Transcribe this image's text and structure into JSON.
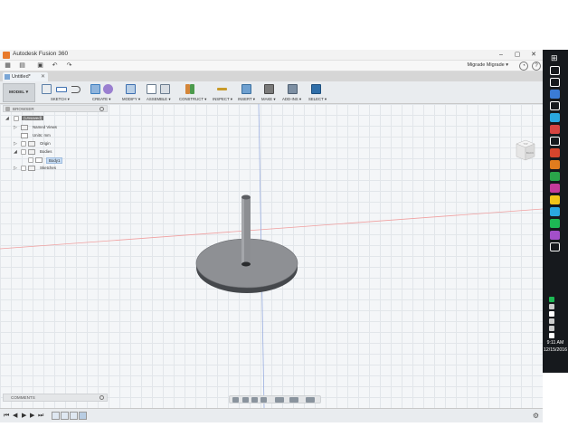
{
  "window": {
    "title": "Autodesk Fusion 360",
    "controls": [
      "–",
      "▢",
      "✕"
    ]
  },
  "quick_access": {
    "user_label": "Migrade Migrade ▾",
    "icons": [
      "grid-icon",
      "file-icon",
      "save-icon",
      "undo-icon",
      "redo-icon"
    ]
  },
  "document_tab": {
    "label": "Untitled*",
    "close": "✕"
  },
  "ribbon": {
    "workspace_label": "MODEL ▾",
    "groups": [
      {
        "label": "SKETCH ▾"
      },
      {
        "label": "CREATE ▾"
      },
      {
        "label": "MODIFY ▾"
      },
      {
        "label": "ASSEMBLE ▾"
      },
      {
        "label": "CONSTRUCT ▾"
      },
      {
        "label": "INSPECT ▾"
      },
      {
        "label": "INSERT ▾"
      },
      {
        "label": "MAKE ▾"
      },
      {
        "label": "ADD-INS ▾"
      },
      {
        "label": "SELECT ▾"
      }
    ],
    "colors": {
      "sketch": "#5b7fa8",
      "create": "#3d7fc0",
      "modify": "#3d6fb0",
      "assemble": "#6b7c8f",
      "construct": "#d4863a",
      "inspect": "#c89a2a",
      "insert": "#4a86b8",
      "make": "#6a6a6a",
      "addins": "#5a6d82",
      "select": "#2f6ea8"
    }
  },
  "browser": {
    "header": "BROWSER",
    "items": [
      {
        "label": "(Unsaved)",
        "level": 0,
        "type": "document"
      },
      {
        "label": "Named Views",
        "level": 1,
        "type": "folder"
      },
      {
        "label": "Units: mm",
        "level": 1,
        "type": "units"
      },
      {
        "label": "Origin",
        "level": 1,
        "type": "folder"
      },
      {
        "label": "Bodies",
        "level": 1,
        "type": "folder"
      },
      {
        "label": "Body1",
        "level": 2,
        "type": "body"
      },
      {
        "label": "Sketches",
        "level": 1,
        "type": "folder"
      }
    ]
  },
  "viewcube": {
    "top_label": "TOP",
    "front_label": "BACK"
  },
  "comments": {
    "label": "COMMENTS"
  },
  "nav_tools": [
    "orbit-icon",
    "pan-icon",
    "zoom-icon",
    "fit-icon",
    "display-icon",
    "grid-settings-icon",
    "viewports-icon"
  ],
  "timeline": {
    "playback": [
      "⏮",
      "◀",
      "▶",
      "▶",
      "⏭"
    ],
    "features": [
      "sketch-feature-icon",
      "sketch-feature-icon",
      "extrude-feature-icon",
      "extrude-feature-icon"
    ],
    "settings_icon": "gear-icon"
  },
  "taskbar": {
    "time": "9:11 AM",
    "date": "12/15/2016",
    "app_colors": [
      "#ffffff",
      "#ffffff",
      "#3a7bd5",
      "#ffffff",
      "#2aa8e0",
      "#d64541",
      "#ffffff",
      "#d6452d",
      "#e07c1e",
      "#2aa54a",
      "#c43a9a",
      "#f0c419",
      "#2aa8e0",
      "#1db954",
      "#a34fc9",
      "#f2f2f2"
    ],
    "tray_colors": [
      "#1db954",
      "#cccccc",
      "#ffffff",
      "#cccccc",
      "#cccccc",
      "#ffffff"
    ]
  }
}
